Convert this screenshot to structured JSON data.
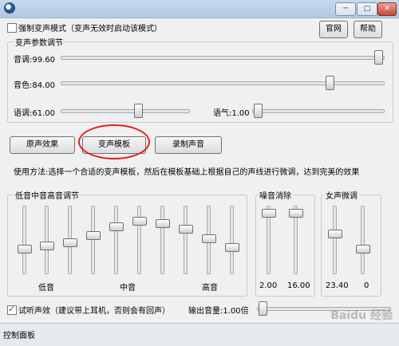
{
  "window": {
    "controls": {
      "minimize": "─",
      "maximize": "□",
      "close": "✕"
    }
  },
  "top": {
    "force_mode_label": "强制变声模式（变声无效时启动该模式）",
    "force_mode_checked": false,
    "website_button": "官网",
    "help_button": "帮助"
  },
  "params": {
    "group_title": "变声参数调节",
    "pitch_label": "音调:99.60",
    "pitch_level": 0.995,
    "timbre_label": "音色:84.00",
    "timbre_level": 0.84,
    "tone_label": "语调:61.00",
    "tone_level": 0.61,
    "mood_label": "语气:1.00",
    "mood_level": 0.01
  },
  "buttons": {
    "original": "原声效果",
    "template": "变声模板",
    "record": "录制声音"
  },
  "usage": "使用方法:选择一个合适的变声模板，然后在模板基础上根据自己的声线进行微调，达到完美的效果",
  "eq": {
    "group_title": "低音中音高音调节",
    "low_label": "低音",
    "mid_label": "中音",
    "high_label": "高音",
    "levels": [
      0.35,
      0.4,
      0.45,
      0.58,
      0.72,
      0.82,
      0.78,
      0.68,
      0.52,
      0.38
    ]
  },
  "noise": {
    "group_title": "噪音消除",
    "values": [
      "2.00",
      "16.00"
    ],
    "levels": [
      0.95,
      0.95
    ]
  },
  "female": {
    "group_title": "女声微调",
    "values": [
      "23.40",
      "0"
    ],
    "levels": [
      0.6,
      0.35
    ]
  },
  "bottom": {
    "monitor_label": "试听声效（建议带上耳机，否则会有回声）",
    "monitor_checked": true,
    "output_volume_label": "输出音量:1.00倍",
    "output_volume_level": 0.01
  },
  "status": {
    "panel_label": "控制面板"
  },
  "watermark": "Baidu 经验"
}
